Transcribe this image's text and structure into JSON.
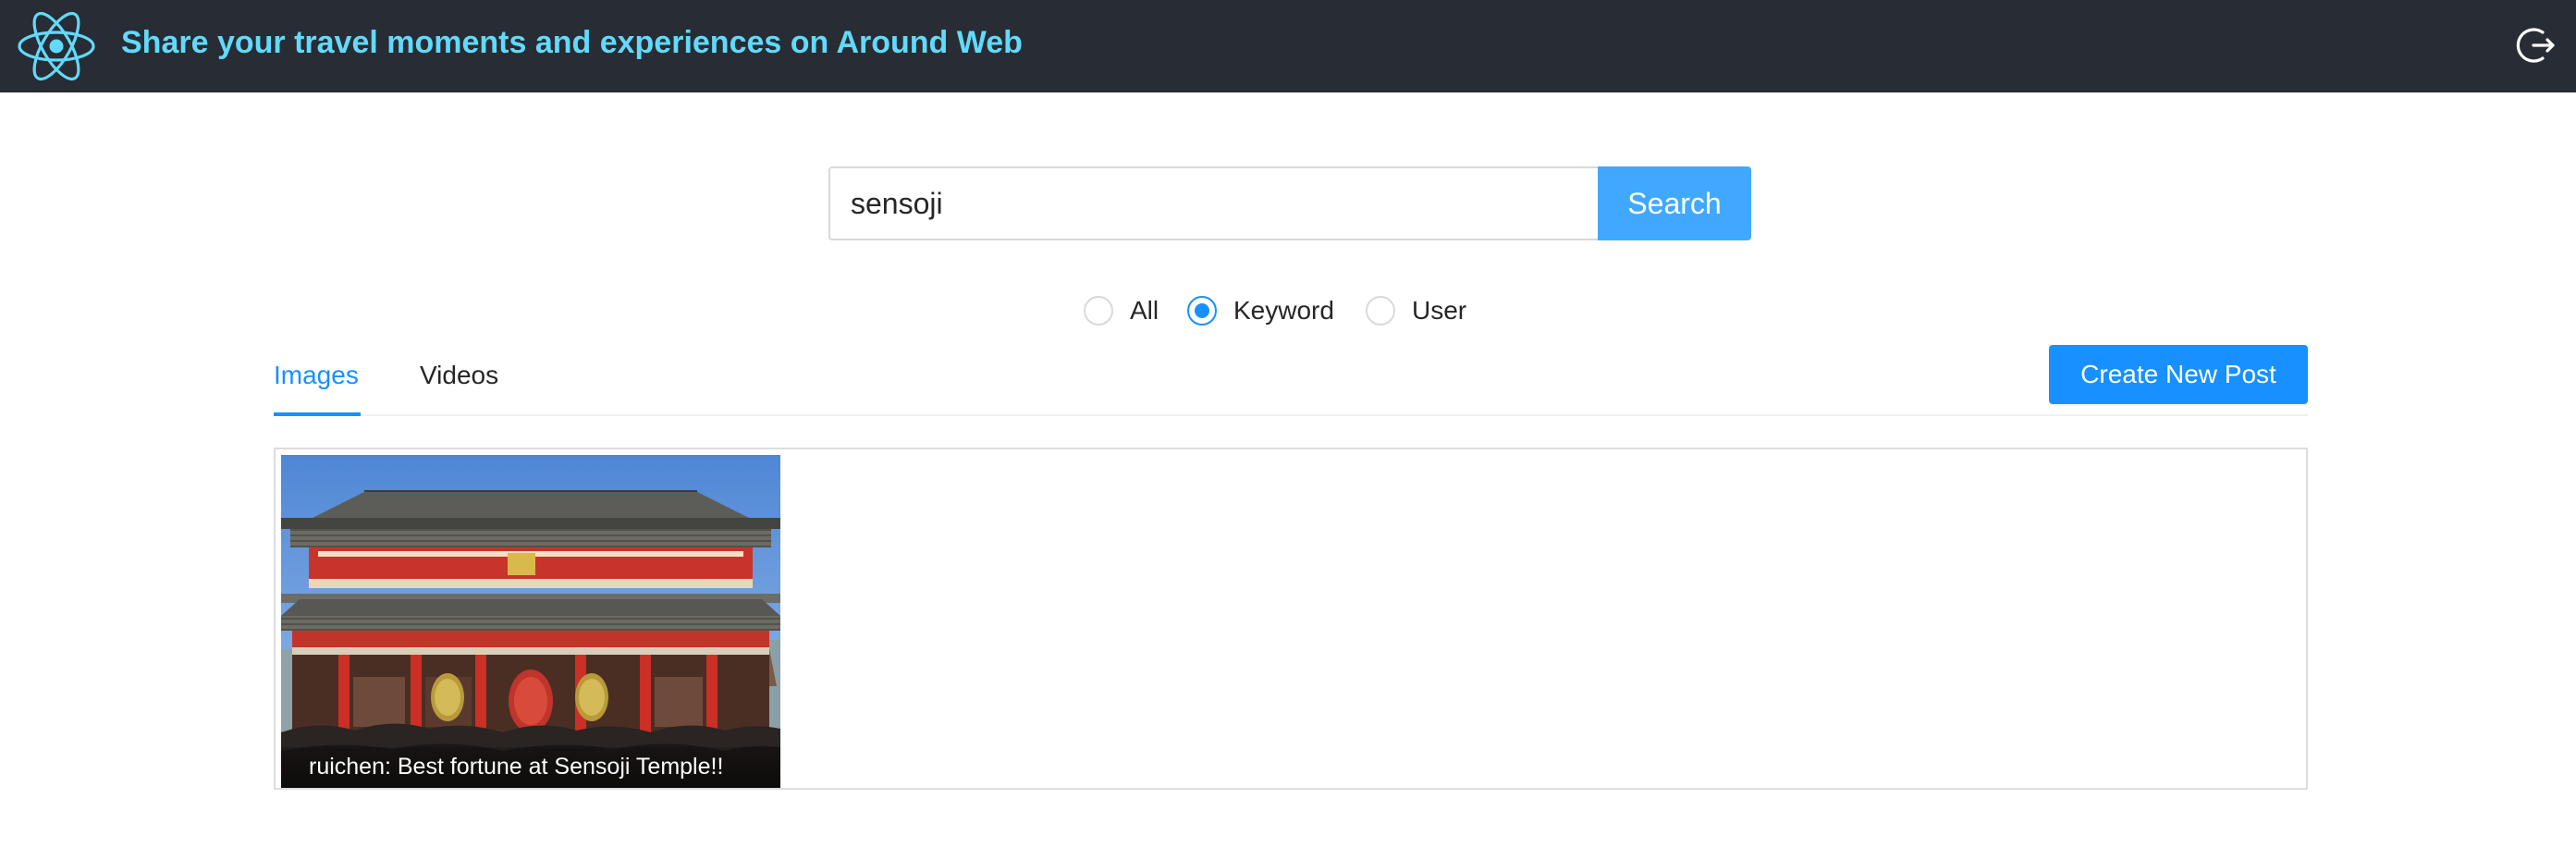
{
  "header": {
    "title": "Share your travel moments and experiences on Around Web",
    "logo_icon": "react-atom-icon",
    "logout_icon": "logout-icon",
    "background": "#282c34",
    "accent": "#61dafb"
  },
  "search": {
    "value": "sensoji",
    "button_label": "Search",
    "options": [
      {
        "label": "All",
        "checked": false
      },
      {
        "label": "Keyword",
        "checked": true
      },
      {
        "label": "User",
        "checked": false
      }
    ]
  },
  "tabs": [
    {
      "label": "Images",
      "active": true
    },
    {
      "label": "Videos",
      "active": false
    }
  ],
  "create_button_label": "Create New Post",
  "gallery": {
    "items": [
      {
        "caption": "ruichen: Best fortune at Sensoji Temple!!"
      }
    ]
  },
  "colors": {
    "primary": "#1890ff",
    "search_button": "#40a9ff"
  }
}
